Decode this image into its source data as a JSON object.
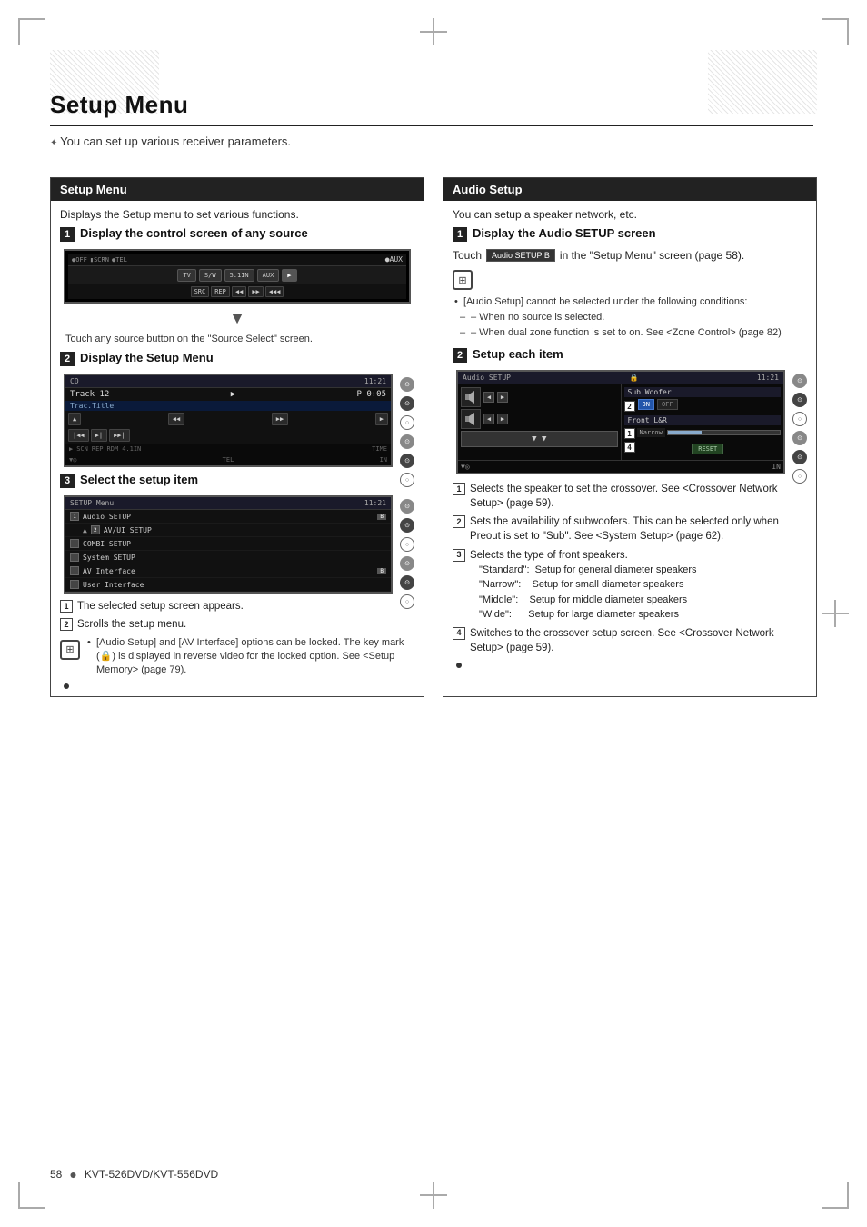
{
  "page": {
    "title": "Setup Menu",
    "subtitle": "You can set up various receiver parameters.",
    "footer_page": "58",
    "footer_model": "KVT-526DVD/KVT-556DVD"
  },
  "left_section": {
    "header": "Setup Menu",
    "description": "Displays the Setup menu to set various functions.",
    "step1": {
      "num": "1",
      "label": "Display the control screen of any source"
    },
    "step1_caption": "Touch any source button on the \"Source Select\" screen.",
    "step2": {
      "num": "2",
      "label": "Display the Setup Menu"
    },
    "step3": {
      "num": "3",
      "label": "Select the setup item"
    },
    "list_item1": "The selected setup screen appears.",
    "list_item2": "Scrolls the setup menu.",
    "note_text": "[Audio Setup]  and [AV Interface] options can be locked. The key mark (🔒) is displayed in reverse video for the locked option. See <Setup Memory> (page 79).",
    "cd_screen": {
      "source": "CD",
      "time": "11:21",
      "track_label": "Track",
      "track_num": "12",
      "play_symbol": "▶",
      "preset": "P",
      "elapsed": "0:05",
      "track_title": "Trac.Title"
    },
    "setup_menu_items": [
      {
        "num": "1",
        "label": "Audio SETUP",
        "badge": "B"
      },
      {
        "num": "",
        "label": "AV/UI SETUP",
        "badge": ""
      },
      {
        "num": "2",
        "label": "COMBI SETUP",
        "badge": ""
      },
      {
        "num": "",
        "label": "System SETUP",
        "badge": ""
      },
      {
        "num": "",
        "label": "AV Interface",
        "badge": "B"
      },
      {
        "num": "",
        "label": "User Interface",
        "badge": ""
      }
    ]
  },
  "right_section": {
    "header": "Audio Setup",
    "description": "You can setup a speaker network, etc.",
    "step1": {
      "num": "1",
      "label": "Display the Audio SETUP screen"
    },
    "touch_text": "Touch",
    "touch_badge": "Audio SETUP          B",
    "touch_suffix": "in the \"Setup Menu\" screen (page 58).",
    "note_text": "[Audio Setup] cannot be selected under the following conditions:",
    "indent1": "– When no source is selected.",
    "indent2": "– When dual zone function is set to on. See <Zone Control> (page 82)",
    "step2": {
      "num": "2",
      "label": "Setup each item"
    },
    "list_items": [
      {
        "num": "1",
        "text": "Selects the speaker to set the crossover. See <Crossover Network Setup> (page 59)."
      },
      {
        "num": "2",
        "text": "Sets the availability of subwoofers. This can be selected only when Preout is set to \"Sub\". See <System Setup> (page 62)."
      },
      {
        "num": "3",
        "text": "Selects the type of front speakers.\n\"Standard\":  Setup for general diameter speakers\n\"Narrow\":    Setup for small diameter speakers\n\"Middle\":    Setup for middle diameter speakers\n\"Wide\":      Setup for large diameter speakers"
      },
      {
        "num": "4",
        "text": "Switches to the crossover setup screen. See <Crossover Network Setup> (page 59)."
      }
    ],
    "audio_screen": {
      "title": "Audio SETUP",
      "time": "11:21",
      "sub_woofer_label": "Sub Woofer",
      "on_label": "ON",
      "off_label": "OFF",
      "front_lr_label": "Front L&R",
      "narrow_label": "Narrow",
      "reset_label": "RESET"
    }
  }
}
